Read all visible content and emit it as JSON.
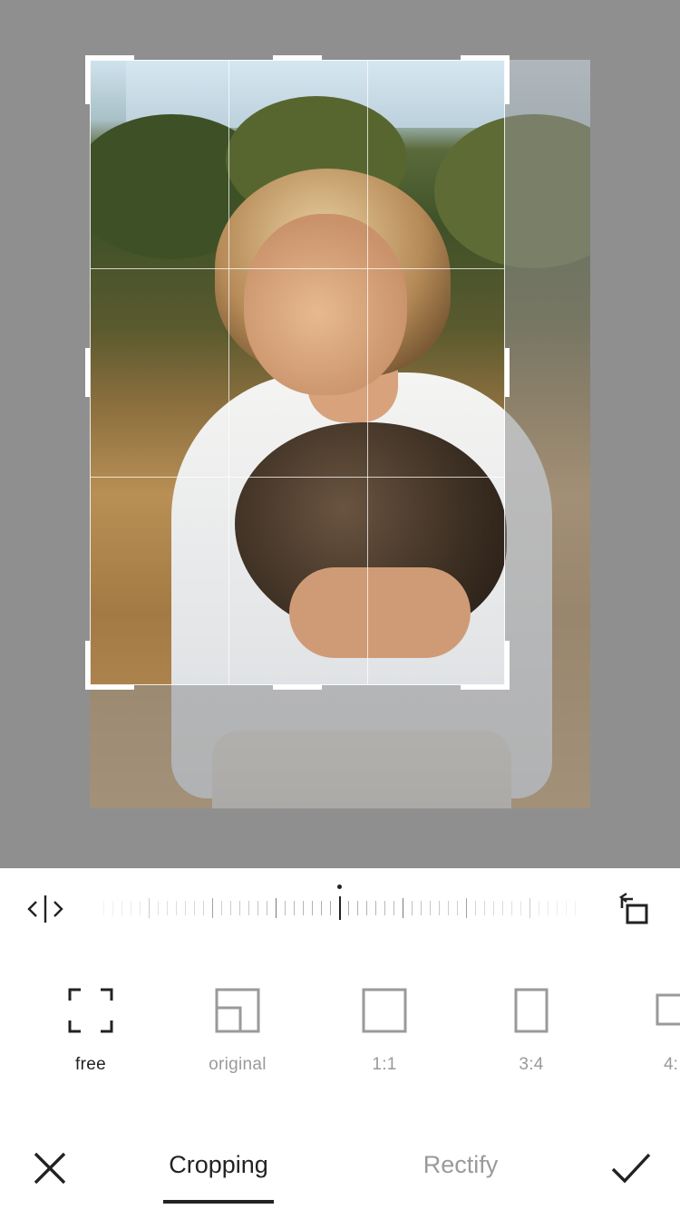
{
  "editor": {
    "screen": "crop-editor",
    "photo_subject": "woman holding a hen"
  },
  "toolbar": {
    "flip_icon": "flip-horizontal-icon",
    "rotate_icon": "rotate-icon",
    "dial_value": 0
  },
  "aspect_ratios": [
    {
      "label": "free",
      "icon": "free-crop-icon",
      "active": true
    },
    {
      "label": "original",
      "icon": "original-ratio-icon",
      "active": false
    },
    {
      "label": "1:1",
      "icon": "square-ratio-icon",
      "active": false
    },
    {
      "label": "3:4",
      "icon": "portrait-ratio-icon",
      "active": false
    },
    {
      "label": "4:",
      "icon": "landscape-ratio-icon",
      "active": false
    }
  ],
  "tabs": [
    {
      "label": "Cropping",
      "active": true
    },
    {
      "label": "Rectify",
      "active": false
    }
  ],
  "actions": {
    "cancel_icon": "close-icon",
    "confirm_icon": "checkmark-icon"
  },
  "colors": {
    "canvas_bg": "#8f8f8f",
    "active_text": "#222222",
    "inactive_text": "#9a9a9a"
  }
}
